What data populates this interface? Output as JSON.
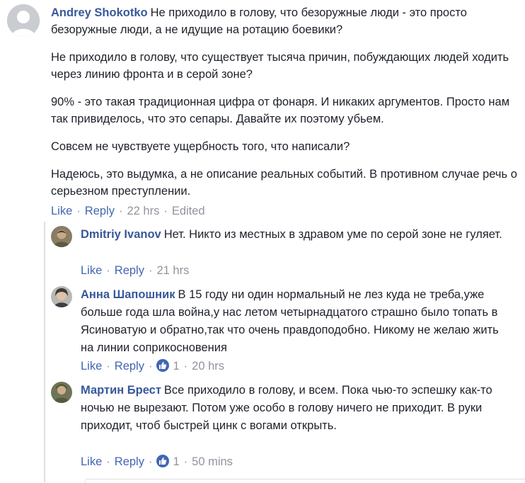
{
  "main_comment": {
    "author": "Andrey Shokotko",
    "avatar": "default-profile-silhouette",
    "paragraphs": [
      "Не приходило в голову, что безоружные люди - это просто безоружные люди, а не идущие на ротацию боевики?",
      "Не приходило в голову, что существует тысяча причин, побуждающих людей ходить через линию фронта и в серой зоне?",
      "90% - это такая традиционная цифра от фонаря. И никаких аргументов. Просто нам так привиделось, что это сепары. Давайте их поэтому убьем.",
      "Совсем не чувствуете ущербность того, что написали?",
      "Надеюсь, это выдумка, а не описание реальных событий. В противном случае речь о серьезном преступлении."
    ],
    "actions": {
      "like": "Like",
      "reply": "Reply",
      "time": "22 hrs",
      "edited": "Edited"
    }
  },
  "separator": "·",
  "replies": [
    {
      "author": "Dmitriy Ivanov",
      "text": "Нет. Никто из местных в здравом уме по серой зоне не гуляет.",
      "like": "Like",
      "reply": "Reply",
      "reactions": "",
      "time": "21 hrs"
    },
    {
      "author": "Анна Шапошник",
      "text": "В 15 году ни один нормальный не лез куда не треба,уже больше года шла война,у нас летом четырнадцатого страшно было топать в Ясиноватую и обратно,так что очень правдоподобно. Никому не желаю жить на линии соприкосновения",
      "like": "Like",
      "reply": "Reply",
      "reactions": "1",
      "time": "20 hrs"
    },
    {
      "author": "Мартин Брест",
      "text": "Все приходило в голову, и всем. Пока чью-то эспешку как-то ночью не вырезают. Потом уже особо в голову ничего не приходит. В руки приходит, чтоб быстрей цинк с вогами открыть.",
      "like": "Like",
      "reply": "Reply",
      "reactions": "1",
      "time": "50 mins"
    }
  ],
  "colors": {
    "author_link": "#385898",
    "action_link": "#4267b2",
    "meta_text": "#90949c",
    "body_text": "#1d2129",
    "like_badge": "#4267b2"
  }
}
